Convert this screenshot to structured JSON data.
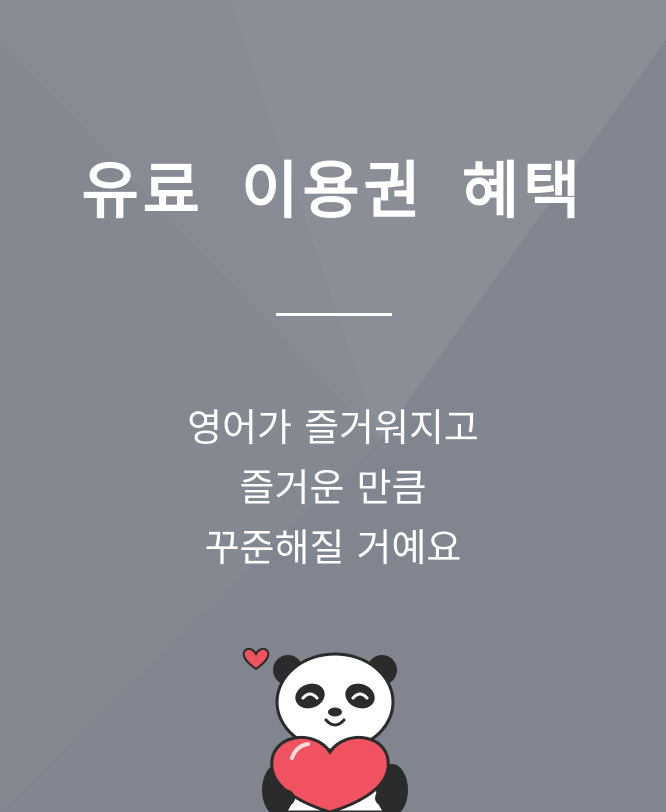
{
  "colors": {
    "background": "#80858f",
    "background_light": "#8b8f97",
    "text": "#ffffff",
    "heart": "#f1525f"
  },
  "header": {
    "title": "유료 이용권 혜택"
  },
  "description": {
    "lines": [
      "영어가 즐거워지고",
      "즐거운 만큼",
      "꾸준해질 거예요"
    ]
  },
  "illustration": {
    "icon": "panda-holding-heart-icon"
  }
}
